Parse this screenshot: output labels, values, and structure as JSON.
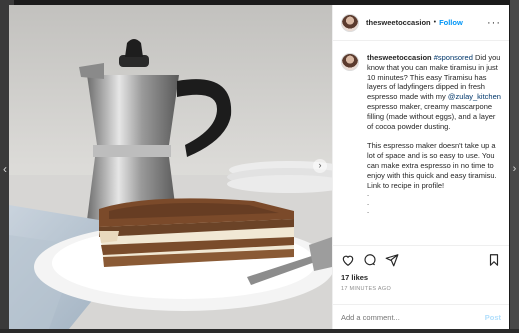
{
  "post": {
    "username": "thesweetoccasion",
    "separator": "•",
    "follow_label": "Follow",
    "more_icon": "more-horizontal-icon",
    "caption": {
      "author": "thesweetoccasion",
      "hashtag": "#sponsored",
      "text_1": " Did you know that you can make tiramisu in just 10 minutes?  This easy Tiramisu has layers of ladyfingers dipped in fresh espresso made with my ",
      "mention": "@zulay_kitchen",
      "text_2": " espresso maker, creamy mascarpone filling (made without eggs), and a layer of cocoa powder dusting.",
      "paragraph_2": "This espresso maker doesn't take up a lot of space and is so easy to use.  You can make extra espresso in no time to enjoy with this quick and easy tiramisu.  Link to recipe in profile!",
      "dots": [
        ".",
        ".",
        "."
      ]
    },
    "likes": "17 likes",
    "timestamp": "17 MINUTES AGO",
    "comment_placeholder": "Add a comment...",
    "post_label": "Post",
    "image_alt": "Tiramisu slice on a white plate in front of a stovetop espresso maker"
  },
  "icons": {
    "heart": "heart-icon",
    "comment": "comment-icon",
    "share": "share-icon",
    "bookmark": "bookmark-icon",
    "prev": "chevron-left-icon",
    "next": "chevron-right-icon"
  },
  "colors": {
    "follow": "#0095f6",
    "link": "#00376b",
    "muted": "#8e8e8e",
    "post_button": "#b2dffc"
  }
}
